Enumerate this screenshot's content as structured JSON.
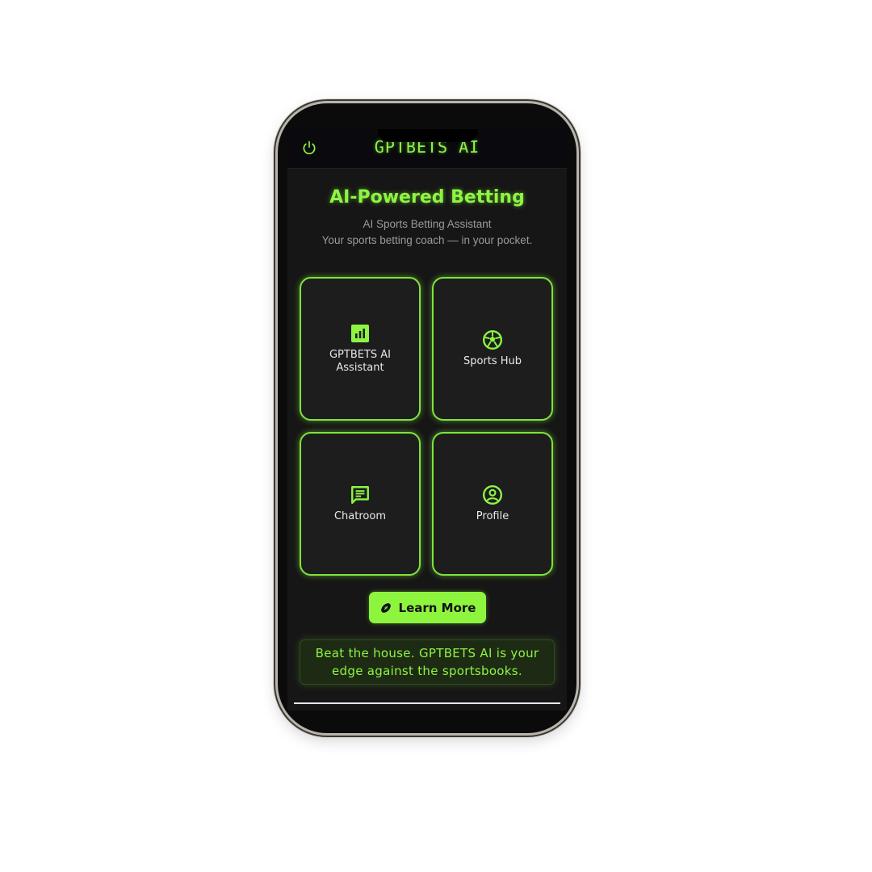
{
  "app": {
    "brand_title": "GPTBETS AI"
  },
  "hero": {
    "title": "AI-Powered Betting",
    "subtitle_line1": "AI Sports Betting Assistant",
    "subtitle_line2": "Your sports betting coach — in your pocket."
  },
  "menu": {
    "items": [
      {
        "label": "GPTBETS AI Assistant",
        "icon": "bar-chart-icon"
      },
      {
        "label": "Sports Hub",
        "icon": "soccer-ball-icon"
      },
      {
        "label": "Chatroom",
        "icon": "chat-bubble-icon"
      },
      {
        "label": "Profile",
        "icon": "user-circle-icon"
      }
    ]
  },
  "cta": {
    "learn_more_label": "Learn More",
    "icon": "football-icon"
  },
  "tagline": "Beat the house. GPTBETS AI is your edge against the sportsbooks.",
  "colors": {
    "accent": "#8df542",
    "background": "#161616",
    "card": "#1d1d1d"
  }
}
